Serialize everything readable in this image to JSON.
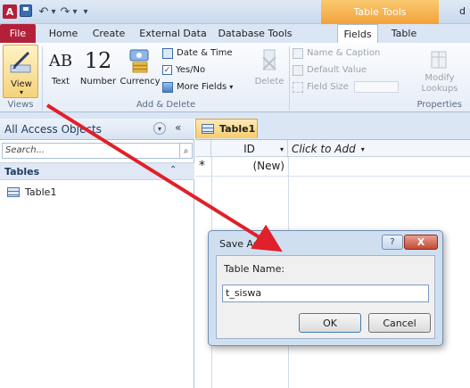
{
  "title_bar": {
    "app_logo_letter": "A",
    "undo_glyph": "↶",
    "redo_glyph": "↷",
    "contextual_tab": "Table Tools",
    "cut_off_text": "d"
  },
  "tabs": [
    {
      "label": "File"
    },
    {
      "label": "Home"
    },
    {
      "label": "Create"
    },
    {
      "label": "External Data"
    },
    {
      "label": "Database Tools"
    },
    {
      "label": "Fields"
    },
    {
      "label": "Table"
    }
  ],
  "ribbon": {
    "view_label": "View",
    "text_icon": "AB",
    "text_label": "Text",
    "number_icon": "12",
    "number_label": "Number",
    "currency_label": "Currency",
    "date_time_label": "Date & Time",
    "yes_no_label": "Yes/No",
    "more_fields_label": "More Fields",
    "delete_label": "Delete",
    "name_caption_label": "Name & Caption",
    "default_value_label": "Default Value",
    "field_size_label": "Field Size",
    "modify_lookups_label_1": "Modify",
    "modify_lookups_label_2": "Lookups",
    "group_views": "Views",
    "group_add_delete": "Add & Delete",
    "group_properties": "Properties"
  },
  "nav_pane": {
    "title": "All Access Objects",
    "search_placeholder": "Search...",
    "section": "Tables",
    "items": [
      {
        "label": "Table1"
      }
    ]
  },
  "document": {
    "tab_label": "Table1",
    "columns": [
      "ID",
      "Click to Add"
    ],
    "new_row_marker": "*",
    "new_row_value": "(New)"
  },
  "dialog": {
    "title": "Save As",
    "field_label": "Table Name:",
    "field_value": "t_siswa",
    "ok_label": "OK",
    "cancel_label": "Cancel",
    "help_glyph": "?",
    "close_glyph": "X"
  },
  "colors": {
    "file_tab": "#b3203a",
    "contextual_tab": "#f2a23b",
    "annotation_arrow": "#e0202a"
  }
}
